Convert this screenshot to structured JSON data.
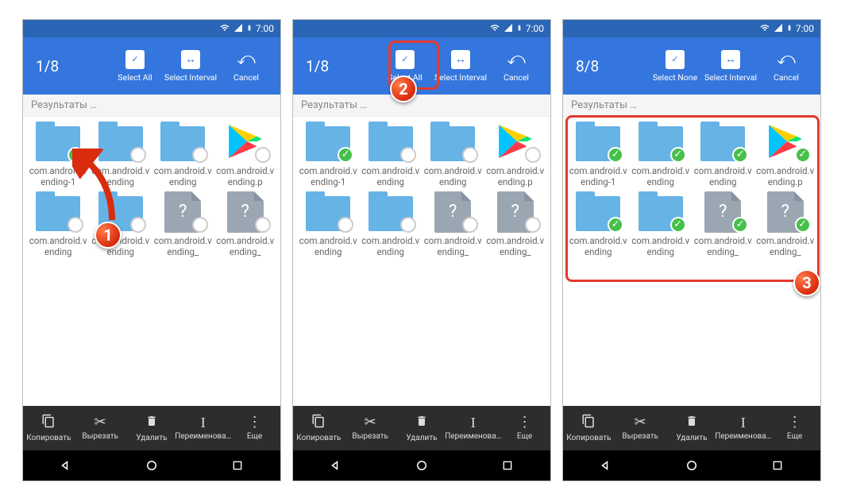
{
  "status": {
    "time": "7:00"
  },
  "toolbar": {
    "select_all": "Select All",
    "select_none": "Select None",
    "select_interval": "Select Interval",
    "cancel": "Cancel"
  },
  "breadcrumb": "Результаты …",
  "actions": {
    "copy": "Копировать",
    "cut": "Вырезать",
    "delete": "Удалить",
    "rename": "Переименова…",
    "more": "Еще"
  },
  "steps": {
    "s1": "1",
    "s2": "2",
    "s3": "3"
  },
  "screens": [
    {
      "counter": "1/8",
      "selectLabelKey": "select_all",
      "items": [
        {
          "name": "com.android.vending-1",
          "type": "folder",
          "selected": true
        },
        {
          "name": "com.android.vending",
          "type": "folder",
          "selected": false
        },
        {
          "name": "com.android.vending",
          "type": "folder",
          "selected": false
        },
        {
          "name": "com.android.vending.p",
          "type": "play",
          "selected": false
        },
        {
          "name": "com.android.vending",
          "type": "folder",
          "selected": false
        },
        {
          "name": "com.android.vending",
          "type": "folder",
          "selected": false
        },
        {
          "name": "com.android.vending_",
          "type": "doc",
          "selected": false
        },
        {
          "name": "com.android.vending_",
          "type": "doc",
          "selected": false
        }
      ]
    },
    {
      "counter": "1/8",
      "selectLabelKey": "select_all",
      "items": [
        {
          "name": "com.android.vending-1",
          "type": "folder",
          "selected": true
        },
        {
          "name": "com.android.vending",
          "type": "folder",
          "selected": false
        },
        {
          "name": "com.android.vending",
          "type": "folder",
          "selected": false
        },
        {
          "name": "com.android.vending.p",
          "type": "play",
          "selected": false
        },
        {
          "name": "com.android.vending",
          "type": "folder",
          "selected": false
        },
        {
          "name": "com.android.vending",
          "type": "folder",
          "selected": false
        },
        {
          "name": "com.android.vending_",
          "type": "doc",
          "selected": false
        },
        {
          "name": "com.android.vending_",
          "type": "doc",
          "selected": false
        }
      ]
    },
    {
      "counter": "8/8",
      "selectLabelKey": "select_none",
      "items": [
        {
          "name": "com.android.vending-1",
          "type": "folder",
          "selected": true
        },
        {
          "name": "com.android.vending",
          "type": "folder",
          "selected": true
        },
        {
          "name": "com.android.vending",
          "type": "folder",
          "selected": true
        },
        {
          "name": "com.android.vending.p",
          "type": "play",
          "selected": true
        },
        {
          "name": "com.android.vending",
          "type": "folder",
          "selected": true
        },
        {
          "name": "com.android.vending",
          "type": "folder",
          "selected": true
        },
        {
          "name": "com.android.vending_",
          "type": "doc",
          "selected": true
        },
        {
          "name": "com.android.vending_",
          "type": "doc",
          "selected": true
        }
      ]
    }
  ]
}
